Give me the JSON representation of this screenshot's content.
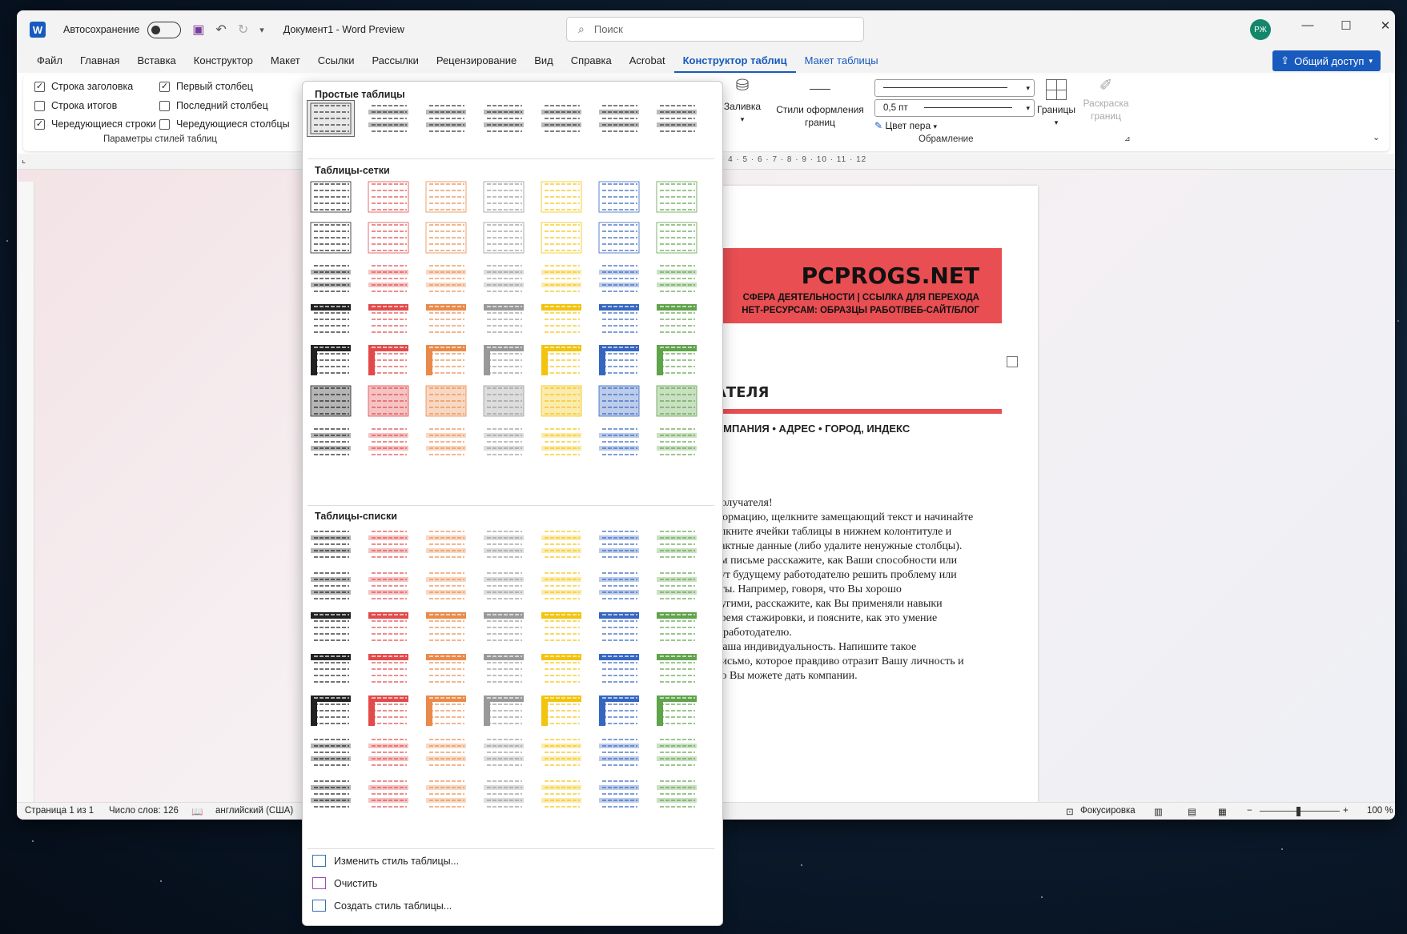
{
  "titlebar": {
    "autosave_label": "Автосохранение",
    "doc_title": "Документ1  -  Word Preview",
    "search_placeholder": "Поиск",
    "avatar_initials": "РЖ"
  },
  "menu_tabs": [
    "Файл",
    "Главная",
    "Вставка",
    "Конструктор",
    "Макет",
    "Ссылки",
    "Рассылки",
    "Рецензирование",
    "Вид",
    "Справка",
    "Acrobat",
    "Конструктор таблиц",
    "Макет таблицы"
  ],
  "share_label": "Общий доступ",
  "style_options": {
    "header_row": "Строка заголовка",
    "total_row": "Строка итогов",
    "banded_rows": "Чередующиеся строки",
    "first_column": "Первый столбец",
    "last_column": "Последний столбец",
    "banded_columns": "Чередующиеся столбцы",
    "group_label": "Параметры стилей таблиц"
  },
  "ribbon": {
    "shading": "Заливка",
    "border_styles_1": "Стили оформления",
    "border_styles_2": "границ",
    "pen_weight": "0,5 пт",
    "pen_color": "Цвет пера",
    "borders": "Границы",
    "painter_1": "Раскраска",
    "painter_2": "границ",
    "group_borders": "Обрамление"
  },
  "gallery": {
    "plain_tables": "Простые таблицы",
    "grid_tables": "Таблицы-сетки",
    "list_tables": "Таблицы-списки",
    "modify": "Изменить стиль таблицы...",
    "clear": "Очистить",
    "new_style": "Создать стиль таблицы...",
    "colors": [
      "#222222",
      "#e24a4a",
      "#e98a4a",
      "#999999",
      "#f2c30f",
      "#3566c0",
      "#5fa34a"
    ]
  },
  "document": {
    "brand": "PCPROGS.NET",
    "banner_line1": "СФЕРА ДЕЯТЕЛЬНОСТИ | ССЫЛКА ДЛЯ ПЕРЕХОДА",
    "banner_line2": "НЕТ-РЕСУРСАМ: ОБРАЗЦЫ РАБОТ/ВЕБ-САЙТ/БЛОГ",
    "recipient_heading": "АТЕЛЯ",
    "address": "ОМПАНИЯ • АДРЕС • ГОРОД, ИНДЕКС",
    "body_lines": [
      "получателя!",
      "формацию, щелкните замещающий текст и начинайте",
      "елкните ячейки таблицы в нижнем колонтитуле и",
      "тактные данные (либо удалите ненужные столбцы).",
      "ом письме расскажите, как Ваши способности или",
      "гут будущему работодателю решить проблему или",
      "аты. Например, говоря, что Вы хорошо",
      "ругими, расскажите, как Вы применяли навыки",
      " время стажировки, и поясните, как это умение",
      "я работодателю.",
      "Ваша индивидуальность. Напишите такое",
      " письмо, которое правдиво отразит Вашу личность и",
      "но Вы можете дать компании."
    ]
  },
  "ruler_text": "· 4 · 5 · 6 · 7 · 8 · 9 · 10 · 11 · 12",
  "status": {
    "page": "Страница 1 из 1",
    "words": "Число слов: 126",
    "language": "английский (США)",
    "focus": "Фокусировка",
    "zoom": "100 %"
  }
}
